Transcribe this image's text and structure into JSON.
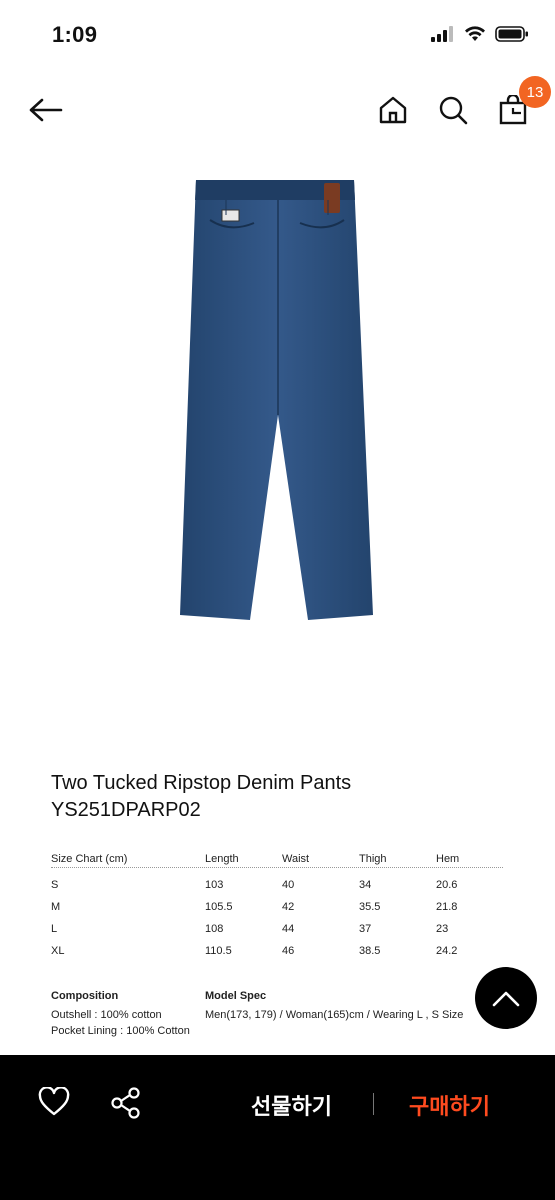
{
  "status": {
    "time": "1:09"
  },
  "nav": {
    "cart_count": "13"
  },
  "product": {
    "title": "Two Tucked Ripstop Denim Pants",
    "code": "YS251DPARP02",
    "denim_color": "#2c4f7c"
  },
  "size_chart": {
    "headers": [
      "Size Chart (cm)",
      "Length",
      "Waist",
      "Thigh",
      "Hem"
    ],
    "rows": [
      [
        "S",
        "103",
        "40",
        "34",
        "20.6"
      ],
      [
        "M",
        "105.5",
        "42",
        "35.5",
        "21.8"
      ],
      [
        "L",
        "108",
        "44",
        "37",
        "23"
      ],
      [
        "XL",
        "110.5",
        "46",
        "38.5",
        "24.2"
      ]
    ]
  },
  "composition": {
    "heading": "Composition",
    "line1": "Outshell : 100% cotton",
    "line2": "Pocket Lining : 100% Cotton"
  },
  "model_spec": {
    "heading": "Model Spec",
    "line1": "Men(173, 179) / Woman(165)cm / Wearing L , S Size"
  },
  "bottom_bar": {
    "gift_label": "선물하기",
    "buy_label": "구매하기",
    "buy_color": "#ff4b1f"
  },
  "icons": [
    "back-arrow-icon",
    "home-icon",
    "search-icon",
    "cart-icon",
    "heart-icon",
    "share-icon",
    "chevron-up-icon",
    "signal-icon",
    "wifi-icon",
    "battery-icon"
  ]
}
